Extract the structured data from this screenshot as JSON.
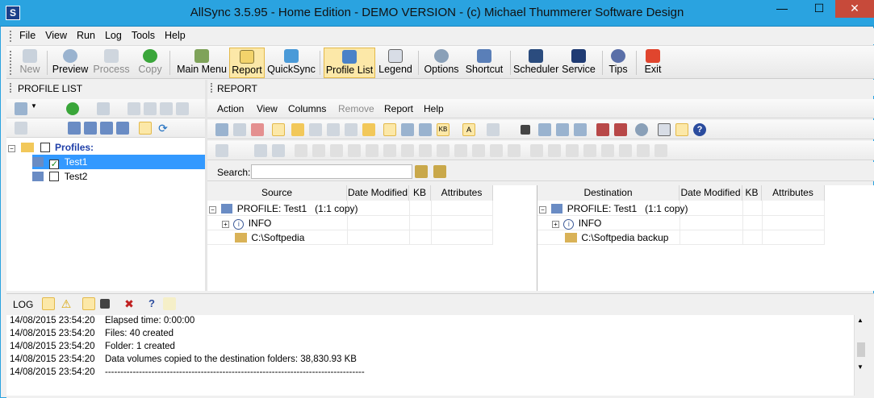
{
  "window": {
    "title": "AllSync 3.5.95 - Home Edition - DEMO VERSION - (c) Michael Thummerer Software Design"
  },
  "menu": [
    "File",
    "View",
    "Run",
    "Log",
    "Tools",
    "Help"
  ],
  "toolbar": {
    "new": "New",
    "preview": "Preview",
    "process": "Process",
    "copy": "Copy",
    "main_menu": "Main Menu",
    "report": "Report",
    "quicksync": "QuickSync",
    "profile_list": "Profile List",
    "legend": "Legend",
    "options": "Options",
    "shortcut": "Shortcut",
    "scheduler": "Scheduler",
    "service": "Service",
    "tips": "Tips",
    "exit": "Exit"
  },
  "profile_list": {
    "header": "PROFILE LIST",
    "root": "Profiles:",
    "items": [
      {
        "name": "Test1",
        "checked": true
      },
      {
        "name": "Test2",
        "checked": false
      }
    ]
  },
  "report": {
    "header": "REPORT",
    "menu": [
      "Action",
      "View",
      "Columns",
      "Remove",
      "Report",
      "Help"
    ],
    "search_label": "Search:",
    "search_value": "",
    "columns": [
      "Date Modified",
      "KB",
      "Attributes"
    ],
    "source": {
      "header": "Source",
      "profile": "PROFILE: Test1   (1:1 copy)",
      "info": "INFO",
      "path": "C:\\Softpedia"
    },
    "destination": {
      "header": "Destination",
      "profile": "PROFILE: Test1   (1:1 copy)",
      "info": "INFO",
      "path": "C:\\Softpedia backup"
    }
  },
  "log": {
    "header": "LOG",
    "rows": [
      {
        "time": "14/08/2015 23:54:20",
        "msg": "Elapsed time: 0:00:00"
      },
      {
        "time": "14/08/2015 23:54:20",
        "msg": "Files: 40 created"
      },
      {
        "time": "14/08/2015 23:54:20",
        "msg": "Folder: 1 created"
      },
      {
        "time": "14/08/2015 23:54:20",
        "msg": "Data volumes copied to the destination folders: 38,830.93 KB"
      },
      {
        "time": "14/08/2015 23:54:20",
        "msg": "------------------------------------------------------------------------------------"
      }
    ]
  },
  "colors": {
    "titlebar": "#2aa3e0",
    "selection": "#3399ff",
    "active_button": "#fce8a8",
    "close_button": "#c74a3a"
  }
}
